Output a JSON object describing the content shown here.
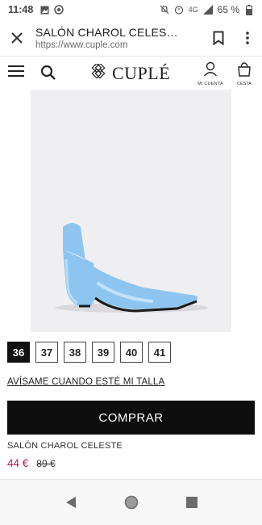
{
  "status_bar": {
    "time": "11:48",
    "network": "4G",
    "battery": "65 %",
    "icons": [
      "image-icon",
      "whatsapp-icon",
      "mute-icon",
      "alarm-icon",
      "signal-icon",
      "battery-icon"
    ]
  },
  "tab": {
    "title": "SALÓN CHAROL CELES…",
    "url": "https://www.cuple.com",
    "icons": [
      "close-icon",
      "bookmark-icon",
      "overflow-menu-icon"
    ]
  },
  "header": {
    "logo": "CUPLÉ",
    "account_label": "MI CUENTA",
    "cart_label": "CESTA",
    "icons": [
      "hamburger-icon",
      "search-icon",
      "logo-icon",
      "account-icon",
      "bag-icon"
    ]
  },
  "product": {
    "image_alt": "blue patent pump",
    "sizes": [
      "36",
      "37",
      "38",
      "39",
      "40",
      "41"
    ],
    "selected_size": "36",
    "notify_label": "AVÍSAME CUANDO ESTÉ MI TALLA",
    "buy_label": "COMPRAR",
    "name": "SALÓN CHAROL CELESTE",
    "price": "44 €",
    "old_price": "89 €"
  },
  "colors": {
    "accent_price": "#c2185b",
    "button_bg": "#0d0d0d",
    "shoe": "#8ec5f0"
  },
  "nav": {
    "icons": [
      "back-icon",
      "home-icon",
      "recents-icon"
    ]
  }
}
